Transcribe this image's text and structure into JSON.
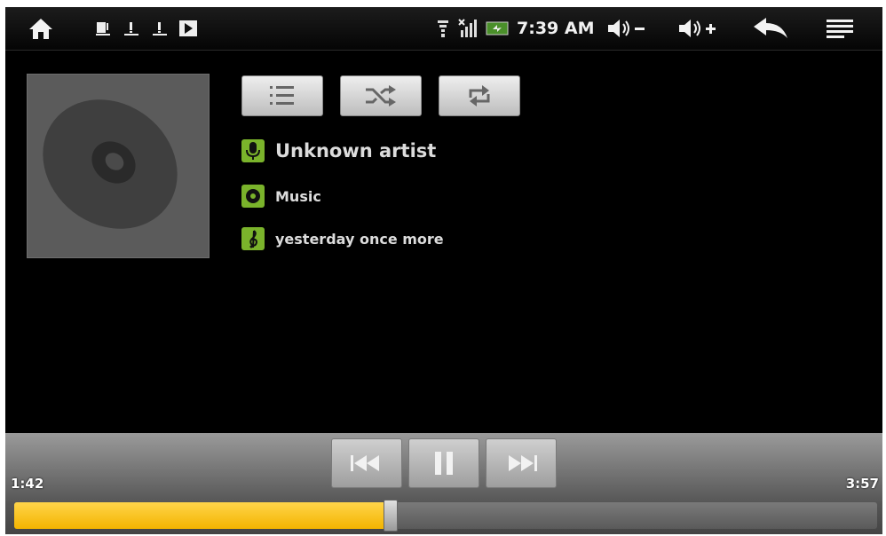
{
  "statusbar": {
    "clock": "7:39 AM",
    "icons": [
      "home-icon",
      "sd-card-icon",
      "warning-icon",
      "warning-icon",
      "play-icon",
      "wifi-icon",
      "signal-icon",
      "battery-icon",
      "volume-down-icon",
      "volume-up-icon",
      "back-icon",
      "menu-icon"
    ]
  },
  "toolbar": {
    "buttons": [
      "playlist-icon",
      "shuffle-icon",
      "repeat-icon"
    ]
  },
  "track": {
    "artist": "Unknown artist",
    "album": "Music",
    "title": "yesterday once more"
  },
  "playback": {
    "elapsed": "1:42",
    "duration": "3:57",
    "progress_fraction": 0.43
  },
  "colors": {
    "accent": "#f3b400",
    "icon_green": "#7ab32b",
    "background": "#000000"
  }
}
